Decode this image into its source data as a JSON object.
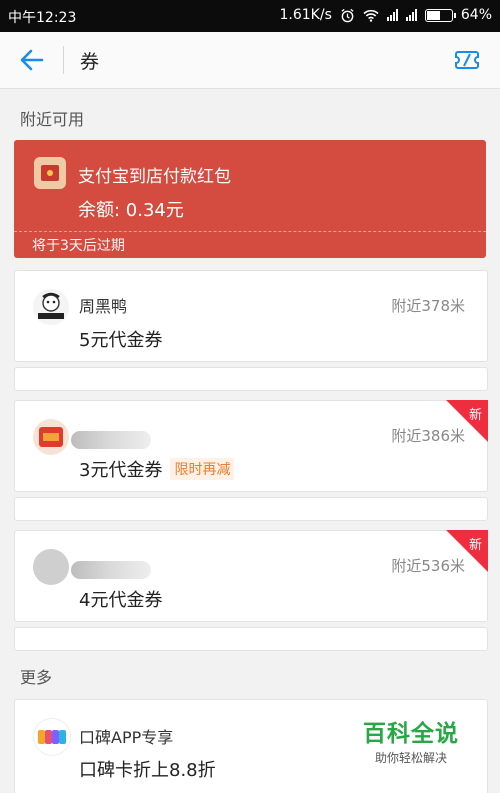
{
  "status_bar": {
    "time": "中午12:23",
    "speed": "1.61K/s",
    "battery": "64%",
    "battery_level": 0.64
  },
  "nav": {
    "title": "券"
  },
  "sections": {
    "nearby": "附近可用",
    "more": "更多"
  },
  "red_packet": {
    "title": "支付宝到店付款红包",
    "balance": "余额: 0.34元",
    "expiry": "将于3天后过期"
  },
  "vouchers": [
    {
      "name": "周黑鸭",
      "distance": "附近378米",
      "value": "5元代金券",
      "tag": "",
      "is_new": false
    },
    {
      "name": "",
      "distance": "附近386米",
      "value": "3元代金券",
      "tag": "限时再减",
      "is_new": true,
      "new_label": "新"
    },
    {
      "name": "",
      "distance": "附近536米",
      "value": "4元代金券",
      "tag": "",
      "is_new": true,
      "new_label": "新"
    }
  ],
  "more_card": {
    "name": "口碑APP专享",
    "value": "口碑卡折上8.8折"
  },
  "watermark": {
    "main": "百科全说",
    "sub": "助你轻松解决"
  },
  "colors": {
    "red_packet_bg": "#d44b3f",
    "accent_blue": "#1a8ce8",
    "new_badge": "#ee2d3f",
    "tag_orange": "#f07b2c"
  }
}
